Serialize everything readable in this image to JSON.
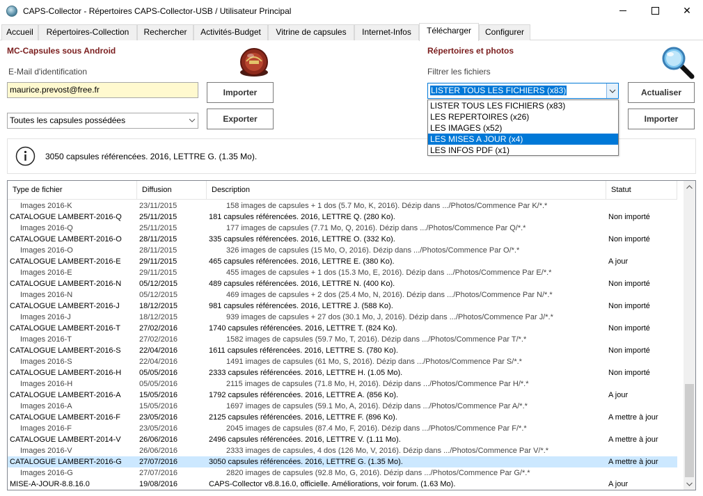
{
  "window": {
    "title": "CAPS-Collector - Répertoires CAPS-Collector-USB / Utilisateur Principal",
    "min_label": "",
    "max_label": "",
    "close_label": "✕"
  },
  "tabs": [
    {
      "label": "Accueil"
    },
    {
      "label": "Répertoires-Collection"
    },
    {
      "label": "Rechercher"
    },
    {
      "label": "Activités-Budget"
    },
    {
      "label": "Vitrine de capsules"
    },
    {
      "label": "Internet-Infos"
    },
    {
      "label": "Télécharger"
    },
    {
      "label": "Configurer"
    }
  ],
  "left_panel": {
    "title": "MC-Capsules sous Android",
    "email_label": "E-Mail d'identification",
    "email_value": "maurice.prevost@free.fr",
    "import_button": "Importer",
    "filter_value": "Toutes les capsules possédées",
    "export_button": "Exporter"
  },
  "right_panel": {
    "title": "Répertoires et photos",
    "filter_label": "Filtrer les fichiers",
    "filter_value": "LISTER TOUS LES FICHIERS (x83)",
    "refresh_button": "Actualiser",
    "import_button": "Importer",
    "dropdown_options": [
      "LISTER TOUS LES FICHIERS (x83)",
      "LES REPERTOIRES (x26)",
      "LES IMAGES (x52)",
      "LES MISES A JOUR (x4)",
      "LES INFOS PDF (x1)"
    ],
    "dropdown_highlighted": "LES MISES A JOUR (x4)"
  },
  "info": {
    "text": "3050 capsules référencées. 2016, LETTRE G. (1.35 Mo)."
  },
  "grid": {
    "headers": [
      "Type de fichier",
      "Diffusion",
      "Description",
      "Statut"
    ],
    "rows": [
      {
        "type": "Images 2016-K",
        "date": "23/11/2015",
        "desc": "158 images de capsules + 1 dos (5.7 Mo, K, 2016). Dézip dans .../Photos/Commence Par K/*.*",
        "status": "",
        "child": true
      },
      {
        "type": "CATALOGUE LAMBERT-2016-Q",
        "date": "25/11/2015",
        "desc": "181 capsules référencées. 2016, LETTRE Q. (280 Ko).",
        "status": "Non importé",
        "child": false
      },
      {
        "type": "Images 2016-Q",
        "date": "25/11/2015",
        "desc": "177 images de capsules (7.71 Mo, Q, 2016). Dézip dans .../Photos/Commence Par Q/*.*",
        "status": "",
        "child": true
      },
      {
        "type": "CATALOGUE LAMBERT-2016-O",
        "date": "28/11/2015",
        "desc": "335 capsules référencées. 2016, LETTRE O. (332 Ko).",
        "status": "Non importé",
        "child": false
      },
      {
        "type": "Images 2016-O",
        "date": "28/11/2015",
        "desc": "326 images de capsules (15 Mo, O, 2016). Dézip dans .../Photos/Commence Par O/*.*",
        "status": "",
        "child": true
      },
      {
        "type": "CATALOGUE LAMBERT-2016-E",
        "date": "29/11/2015",
        "desc": "465 capsules référencées. 2016, LETTRE E. (380 Ko).",
        "status": "A jour",
        "child": false
      },
      {
        "type": "Images 2016-E",
        "date": "29/11/2015",
        "desc": "455 images de capsules + 1 dos (15.3 Mo, E, 2016). Dézip dans .../Photos/Commence Par E/*.*",
        "status": "",
        "child": true
      },
      {
        "type": "CATALOGUE LAMBERT-2016-N",
        "date": "05/12/2015",
        "desc": "489 capsules référencées. 2016, LETTRE N. (400 Ko).",
        "status": "Non importé",
        "child": false
      },
      {
        "type": "Images 2016-N",
        "date": "05/12/2015",
        "desc": "469 images de capsules + 2 dos (25.4 Mo, N, 2016). Dézip dans .../Photos/Commence Par N/*.*",
        "status": "",
        "child": true
      },
      {
        "type": "CATALOGUE LAMBERT-2016-J",
        "date": "18/12/2015",
        "desc": "981 capsules référencées. 2016, LETTRE J. (588 Ko).",
        "status": "Non importé",
        "child": false
      },
      {
        "type": "Images 2016-J",
        "date": "18/12/2015",
        "desc": "939 images de capsules + 27 dos (30.1 Mo, J, 2016). Dézip dans .../Photos/Commence Par J/*.*",
        "status": "",
        "child": true
      },
      {
        "type": "CATALOGUE LAMBERT-2016-T",
        "date": "27/02/2016",
        "desc": "1740 capsules référencées. 2016, LETTRE T. (824 Ko).",
        "status": "Non importé",
        "child": false
      },
      {
        "type": "Images 2016-T",
        "date": "27/02/2016",
        "desc": "1582 images de capsules (59.7 Mo, T, 2016). Dézip dans .../Photos/Commence Par T/*.*",
        "status": "",
        "child": true
      },
      {
        "type": "CATALOGUE LAMBERT-2016-S",
        "date": "22/04/2016",
        "desc": "1611 capsules référencées. 2016, LETTRE S. (780 Ko).",
        "status": "Non importé",
        "child": false
      },
      {
        "type": "Images 2016-S",
        "date": "22/04/2016",
        "desc": "1491 images de capsules (61 Mo, S, 2016). Dézip dans .../Photos/Commence Par S/*.*",
        "status": "",
        "child": true
      },
      {
        "type": "CATALOGUE LAMBERT-2016-H",
        "date": "05/05/2016",
        "desc": "2333 capsules référencées. 2016, LETTRE H. (1.05 Mo).",
        "status": "Non importé",
        "child": false
      },
      {
        "type": "Images 2016-H",
        "date": "05/05/2016",
        "desc": "2115 images de capsules (71.8 Mo, H, 2016). Dézip dans .../Photos/Commence Par H/*.*",
        "status": "",
        "child": true
      },
      {
        "type": "CATALOGUE LAMBERT-2016-A",
        "date": "15/05/2016",
        "desc": "1792 capsules référencées. 2016, LETTRE A. (856 Ko).",
        "status": "A jour",
        "child": false
      },
      {
        "type": "Images 2016-A",
        "date": "15/05/2016",
        "desc": "1697 images de capsules (59.1 Mo, A, 2016). Dézip dans .../Photos/Commence Par A/*.*",
        "status": "",
        "child": true
      },
      {
        "type": "CATALOGUE LAMBERT-2016-F",
        "date": "23/05/2016",
        "desc": "2125 capsules référencées. 2016, LETTRE F. (896 Ko).",
        "status": "A mettre à jour",
        "child": false
      },
      {
        "type": "Images 2016-F",
        "date": "23/05/2016",
        "desc": "2045 images de capsules (87.4 Mo, F, 2016). Dézip dans .../Photos/Commence Par F/*.*",
        "status": "",
        "child": true
      },
      {
        "type": "CATALOGUE LAMBERT-2014-V",
        "date": "26/06/2016",
        "desc": "2496 capsules référencées. 2016, LETTRE V. (1.11 Mo).",
        "status": "A mettre à jour",
        "child": false
      },
      {
        "type": "Images 2016-V",
        "date": "26/06/2016",
        "desc": "2333 images de capsules, 4 dos (126 Mo, V, 2016). Dézip dans .../Photos/Commence Par V/*.*",
        "status": "",
        "child": true
      },
      {
        "type": "CATALOGUE LAMBERT-2016-G",
        "date": "27/07/2016",
        "desc": "3050 capsules référencées. 2016, LETTRE G. (1.35 Mo).",
        "status": "A mettre à jour",
        "child": false,
        "selected": true
      },
      {
        "type": "Images 2016-G",
        "date": "27/07/2016",
        "desc": "2820 images de capsules (92.8 Mo, G, 2016). Dézip dans .../Photos/Commence Par G/*.*",
        "status": "",
        "child": true
      },
      {
        "type": "MISE-A-JOUR-8.8.16.0",
        "date": "19/08/2016",
        "desc": "CAPS-Collector v8.8.16.0, officielle. Améliorations, voir forum. (1.63 Mo).",
        "status": "A jour",
        "child": false
      }
    ]
  },
  "colors": {
    "panel_title": "#7a1d1d",
    "selection_blue": "#0078d7",
    "row_selected": "#cce8ff",
    "email_bg": "#fff9cf"
  }
}
